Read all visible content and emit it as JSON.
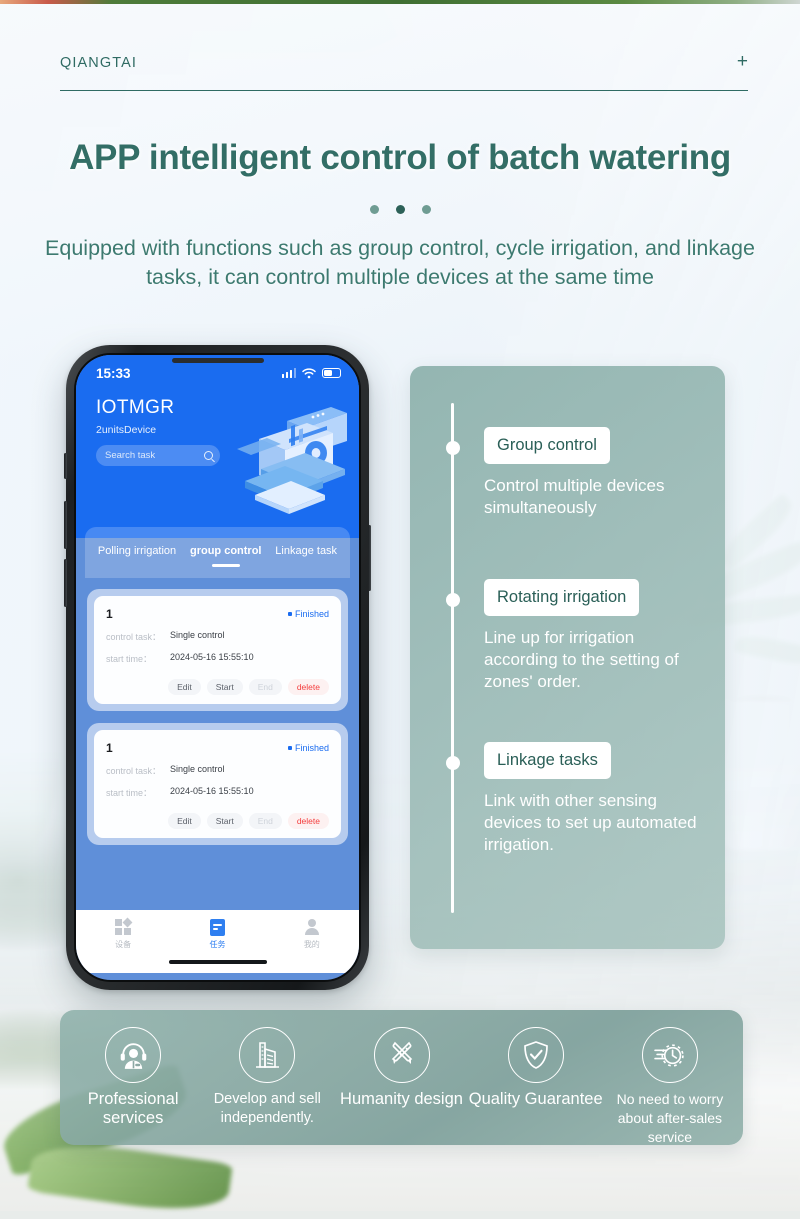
{
  "page": {
    "accent_teal": "#2f6b63",
    "panel_teal": "#8db1ac",
    "app_blue": "#1a6cf0"
  },
  "header": {
    "brand": "QIANGTAI",
    "add_label": "+"
  },
  "hero": {
    "headline": "APP intelligent control of batch watering",
    "subhead": "Equipped with functions such as group control, cycle irrigation, and linkage tasks, it can control multiple devices at the same time"
  },
  "phone": {
    "status": {
      "time": "15:33",
      "signal_icon": "signal-bars-icon",
      "wifi_icon": "wifi-icon",
      "battery_icon": "battery-icon"
    },
    "app": {
      "title": "IOTMGR",
      "subtitle": "2unitsDevice",
      "search_placeholder": "Search task",
      "search_icon": "search-icon",
      "illustration": "iot-dashboard-illustration"
    },
    "tabs": [
      {
        "label": "Polling irrigation",
        "active": false
      },
      {
        "label": "group control",
        "active": true
      },
      {
        "label": "Linkage task",
        "active": false
      }
    ],
    "tasks": [
      {
        "number": "1",
        "status": "Finished",
        "control_task_key": "control task：",
        "control_task_value": "Single control",
        "start_time_key": "start time：",
        "start_time_value": "2024-05-16 15:55:10",
        "buttons": [
          "Edit",
          "Start",
          "End",
          "delete"
        ]
      },
      {
        "number": "1",
        "status": "Finished",
        "control_task_key": "control task：",
        "control_task_value": "Single control",
        "start_time_key": "start time：",
        "start_time_value": "2024-05-16 15:55:10",
        "buttons": [
          "Edit",
          "Start",
          "End",
          "delete"
        ]
      }
    ],
    "tabbar": [
      {
        "label": "设备",
        "icon": "grid-icon",
        "active": false
      },
      {
        "label": "任务",
        "icon": "task-document-icon",
        "active": true
      },
      {
        "label": "我的",
        "icon": "person-icon",
        "active": false
      }
    ]
  },
  "features": [
    {
      "chip": "Group control",
      "desc": "Control multiple devices simultaneously"
    },
    {
      "chip": "Rotating irrigation",
      "desc": "Line up for irrigation according to the setting of zones' order."
    },
    {
      "chip": "Linkage tasks",
      "desc": "Link with other sensing devices to set up automated irrigation."
    }
  ],
  "strip": [
    {
      "label": "Professional services",
      "icon": "headset-support-icon"
    },
    {
      "label": "Develop and sell independently.",
      "icon": "building-icon"
    },
    {
      "label": "Humanity design",
      "icon": "pencil-ruler-icon"
    },
    {
      "label": "Quality Guarantee",
      "icon": "shield-check-icon"
    },
    {
      "label": "No need to worry about after-sales service",
      "icon": "fast-clock-icon"
    }
  ]
}
